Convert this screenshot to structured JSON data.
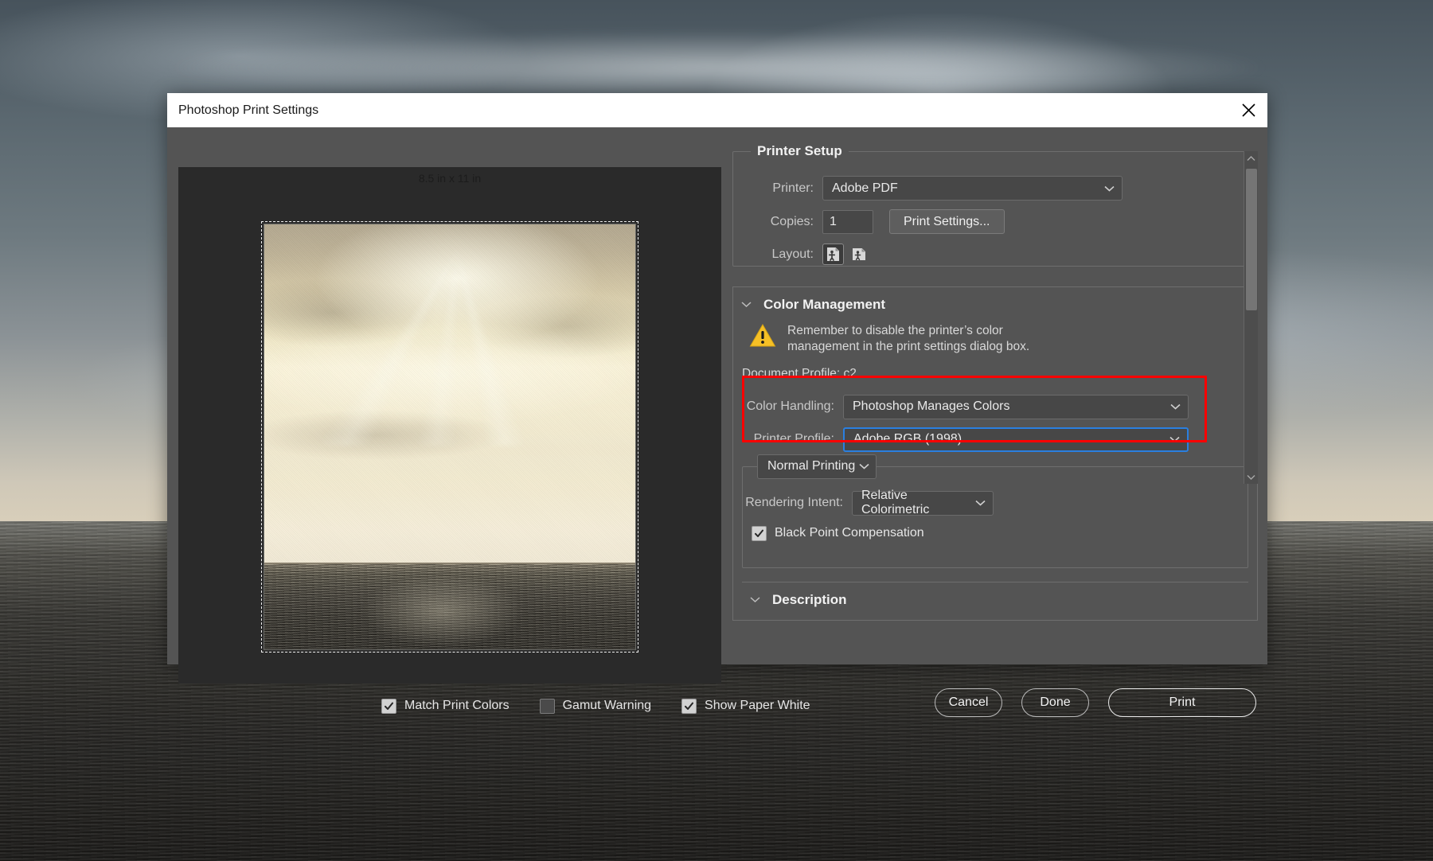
{
  "window": {
    "title": "Photoshop Print Settings",
    "close_icon": "close-icon"
  },
  "preview": {
    "dimensions_label": "8.5 in x 11 in"
  },
  "preview_options": [
    {
      "label": "Match Print Colors",
      "checked": true
    },
    {
      "label": "Gamut Warning",
      "checked": false
    },
    {
      "label": "Show Paper White",
      "checked": true
    }
  ],
  "printer_setup": {
    "legend": "Printer Setup",
    "printer_label": "Printer:",
    "printer_value": "Adobe PDF",
    "copies_label": "Copies:",
    "copies_value": "1",
    "print_settings_button": "Print Settings...",
    "layout_label": "Layout:",
    "layout_portrait_icon": "page-portrait-icon",
    "layout_landscape_icon": "page-landscape-icon"
  },
  "color_management": {
    "section_title": "Color Management",
    "collapse_icon": "chevron-down-icon",
    "warning_icon": "warning-triangle-icon",
    "warning_line1": "Remember to disable the printer’s color",
    "warning_line2": "management in the print settings dialog box.",
    "document_profile_label": "Document Profile:",
    "document_profile_value": "c2",
    "color_handling_label": "Color Handling:",
    "color_handling_value": "Photoshop Manages Colors",
    "printer_profile_label": "Printer Profile:",
    "printer_profile_value": "Adobe RGB (1998)",
    "normal_printing_value": "Normal Printing",
    "rendering_intent_label": "Rendering Intent:",
    "rendering_intent_value": "Relative Colorimetric",
    "black_point_label": "Black Point Compensation",
    "black_point_checked": true,
    "description_title": "Description",
    "highlight_color": "#ff0000",
    "focus_color": "#2a7fe0"
  },
  "footer": {
    "cancel": "Cancel",
    "done": "Done",
    "print": "Print"
  }
}
